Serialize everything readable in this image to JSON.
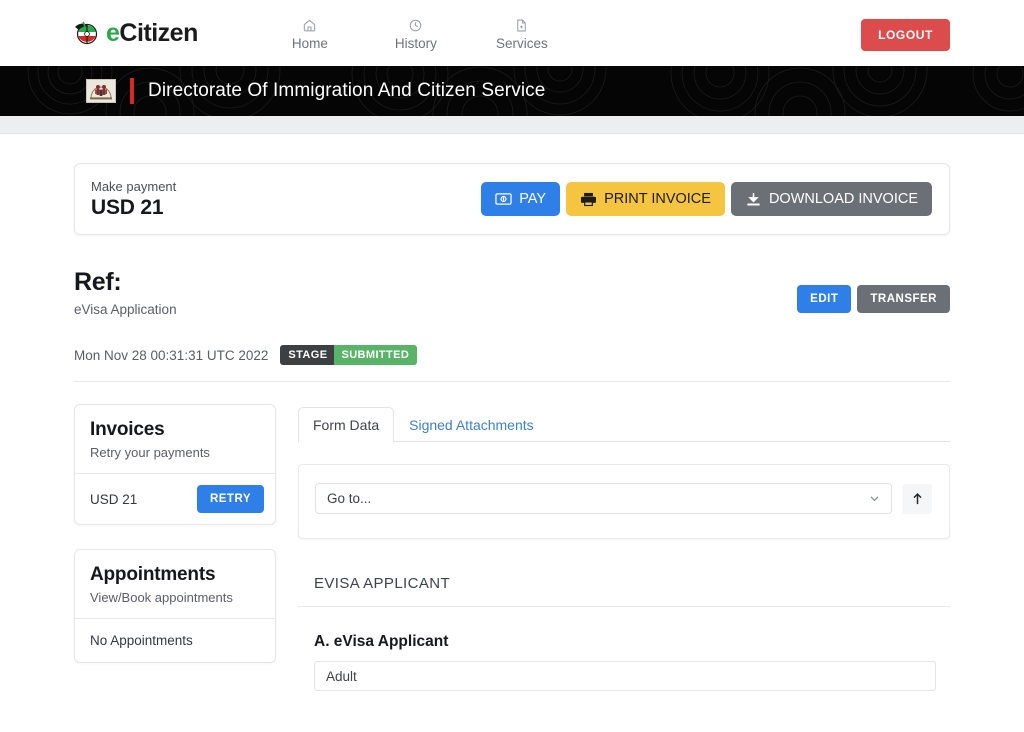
{
  "topnav": {
    "brand": {
      "prefix": "e",
      "rest": "Citizen",
      "emblem_icon": "ecitizen-emblem-icon"
    },
    "links": [
      {
        "label": "Home",
        "icon": "home-icon"
      },
      {
        "label": "History",
        "icon": "clock-icon"
      },
      {
        "label": "Services",
        "icon": "document-plus-icon"
      }
    ],
    "logout_label": "LOGOUT",
    "logout_color": "#dc4c4c"
  },
  "banner": {
    "crest_icon": "coat-of-arms-icon",
    "title": "Directorate Of Immigration And Citizen Service",
    "accent_color": "#d62828",
    "background_color": "#050505"
  },
  "payment": {
    "label": "Make payment",
    "amount": "USD 21",
    "buttons": [
      {
        "label": "PAY",
        "icon": "money-bill-icon",
        "color": "#2f7fe8"
      },
      {
        "label": "PRINT INVOICE",
        "icon": "printer-icon",
        "color": "#f5c542"
      },
      {
        "label": "DOWNLOAD INVOICE",
        "icon": "download-icon",
        "color": "#6b7077"
      }
    ]
  },
  "ref": {
    "title": "Ref:",
    "subtitle": "eVisa Application",
    "edit_label": "EDIT",
    "transfer_label": "TRANSFER",
    "date": "Mon Nov 28 00:31:31 UTC 2022",
    "stage_key": "STAGE",
    "stage_value": "SUBMITTED",
    "stage_key_color": "#3c4043",
    "stage_value_color": "#59b368"
  },
  "invoices": {
    "title": "Invoices",
    "subtitle": "Retry your payments",
    "rows": [
      {
        "amount": "USD 21",
        "action_label": "RETRY"
      }
    ]
  },
  "appointments": {
    "title": "Appointments",
    "subtitle": "View/Book appointments",
    "empty_text": "No Appointments"
  },
  "tabs": [
    {
      "label": "Form Data",
      "active": true
    },
    {
      "label": "Signed Attachments",
      "active": false
    }
  ],
  "goto": {
    "value": "Go to...",
    "chevron_icon": "chevron-down-icon",
    "scroll_top_icon": "arrow-up-icon"
  },
  "form": {
    "section_title": "EVISA APPLICANT",
    "field_label": "A. eVisa Applicant",
    "field_value": "Adult"
  }
}
